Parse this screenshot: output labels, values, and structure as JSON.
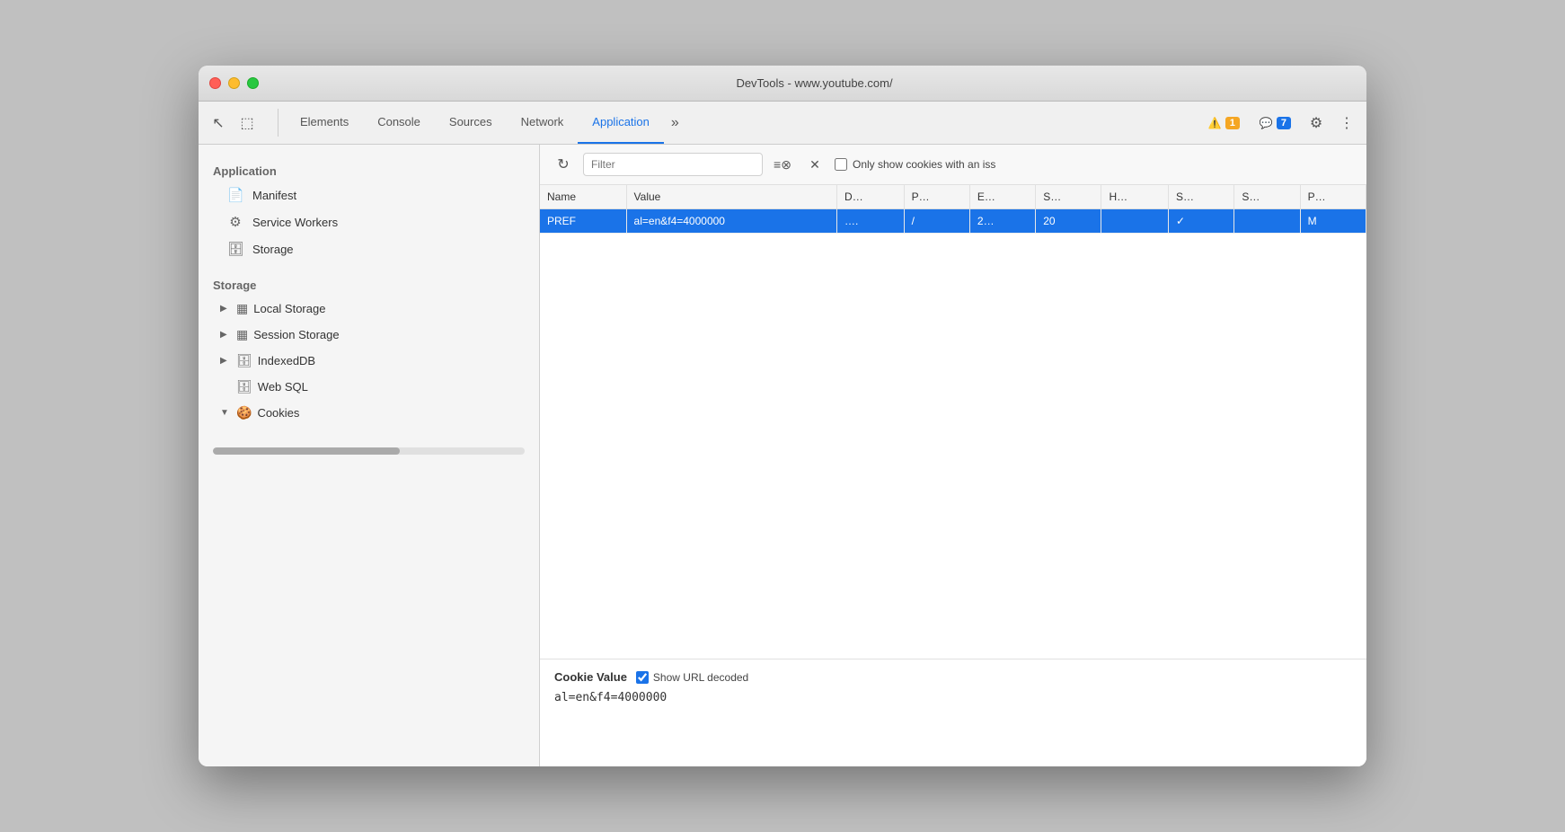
{
  "window": {
    "title": "DevTools - www.youtube.com/"
  },
  "tabs": {
    "items": [
      {
        "label": "Elements",
        "active": false
      },
      {
        "label": "Console",
        "active": false
      },
      {
        "label": "Sources",
        "active": false
      },
      {
        "label": "Network",
        "active": false
      },
      {
        "label": "Application",
        "active": true
      }
    ],
    "more_label": "»",
    "warning_badge": "1",
    "info_badge": "7"
  },
  "sidebar": {
    "application_section": "Application",
    "storage_section": "Storage",
    "app_items": [
      {
        "label": "Manifest",
        "icon": "📄"
      },
      {
        "label": "Service Workers",
        "icon": "⚙"
      },
      {
        "label": "Storage",
        "icon": "🗄"
      }
    ],
    "storage_items": [
      {
        "label": "Local Storage",
        "icon": "▦",
        "expanded": false
      },
      {
        "label": "Session Storage",
        "icon": "▦",
        "expanded": false
      },
      {
        "label": "IndexedDB",
        "icon": "🗄",
        "expanded": false
      },
      {
        "label": "Web SQL",
        "icon": "🗄",
        "expanded": false
      },
      {
        "label": "Cookies",
        "icon": "🍪",
        "expanded": true
      }
    ]
  },
  "cookie_panel": {
    "filter_placeholder": "Filter",
    "only_show_label": "Only show cookies with an iss",
    "table": {
      "columns": [
        "Name",
        "Value",
        "D…",
        "P…",
        "E…",
        "S…",
        "H…",
        "S…",
        "S…",
        "P…"
      ],
      "rows": [
        {
          "name": "PREF",
          "value": "al=en&f4=4000000",
          "domain": "….",
          "path": "/",
          "expires": "2…",
          "size": "20",
          "http": "",
          "secure": "✓",
          "samesite": "",
          "priority": "M",
          "selected": true
        }
      ]
    },
    "detail": {
      "label": "Cookie Value",
      "show_decoded": true,
      "show_decoded_label": "Show URL decoded",
      "value": "al=en&f4=4000000"
    }
  },
  "icons": {
    "cursor_icon": "↖",
    "inspect_icon": "⬚",
    "refresh_icon": "↻",
    "clear_icon": "⊗",
    "filter_icon": "≡⊗",
    "close_icon": "✕",
    "gear_icon": "⚙",
    "more_icon": "⋮"
  }
}
